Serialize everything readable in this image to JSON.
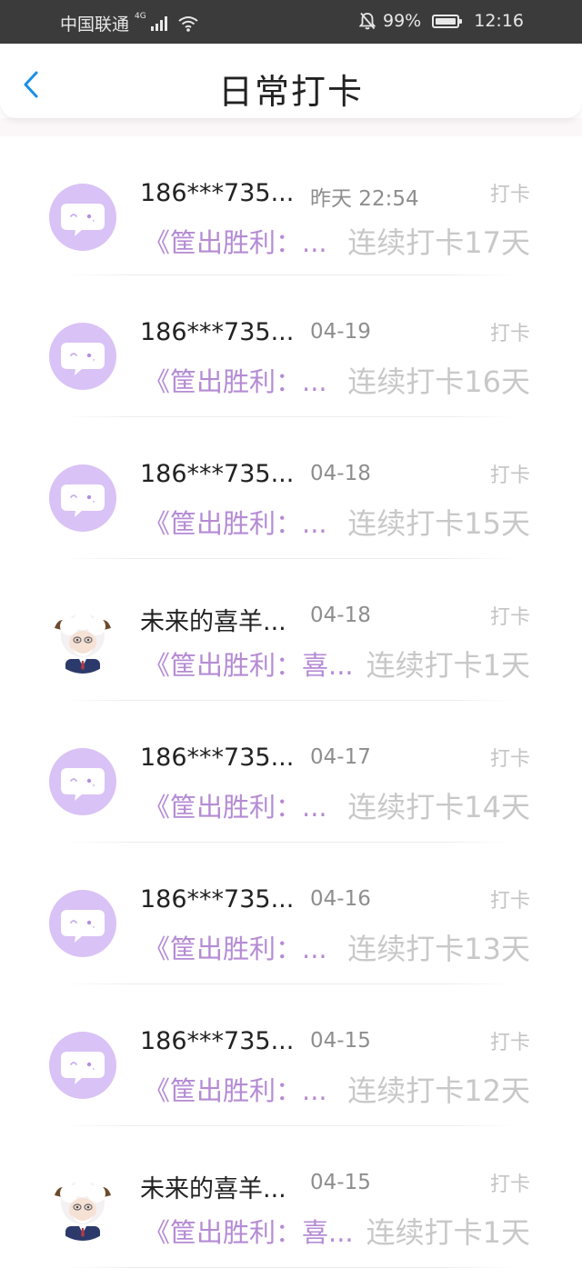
{
  "status_bar": {
    "carrier": "中国联通",
    "network": "4G",
    "battery": "99%",
    "time": "12:16"
  },
  "header": {
    "title": "日常打卡"
  },
  "items": [
    {
      "name": "186***735...",
      "time": "昨天 22:54",
      "tag": "打卡",
      "book": "《筐出胜利：...",
      "streak": "连续打卡17天",
      "avatar": "bubble"
    },
    {
      "name": "186***735...",
      "time": "04-19",
      "tag": "打卡",
      "book": "《筐出胜利：...",
      "streak": "连续打卡16天",
      "avatar": "bubble"
    },
    {
      "name": "186***735...",
      "time": "04-18",
      "tag": "打卡",
      "book": "《筐出胜利：...",
      "streak": "连续打卡15天",
      "avatar": "bubble"
    },
    {
      "name": "未来的喜羊...",
      "time": "04-18",
      "tag": "打卡",
      "book": "《筐出胜利：喜...",
      "streak": "连续打卡1天",
      "avatar": "sheep"
    },
    {
      "name": "186***735...",
      "time": "04-17",
      "tag": "打卡",
      "book": "《筐出胜利：...",
      "streak": "连续打卡14天",
      "avatar": "bubble"
    },
    {
      "name": "186***735...",
      "time": "04-16",
      "tag": "打卡",
      "book": "《筐出胜利：...",
      "streak": "连续打卡13天",
      "avatar": "bubble"
    },
    {
      "name": "186***735...",
      "time": "04-15",
      "tag": "打卡",
      "book": "《筐出胜利：...",
      "streak": "连续打卡12天",
      "avatar": "bubble"
    },
    {
      "name": "未来的喜羊...",
      "time": "04-15",
      "tag": "打卡",
      "book": "《筐出胜利：喜...",
      "streak": "连续打卡1天",
      "avatar": "sheep"
    }
  ],
  "colors": {
    "accent": "#1a8fe8",
    "book_purple": "#b58bd4",
    "avatar_bubble": "#d9c2f5"
  },
  "icons": {
    "back": "chevron-left-icon",
    "avatar_default": "chat-bubble-icon",
    "avatar_user": "sheep-character-avatar"
  }
}
